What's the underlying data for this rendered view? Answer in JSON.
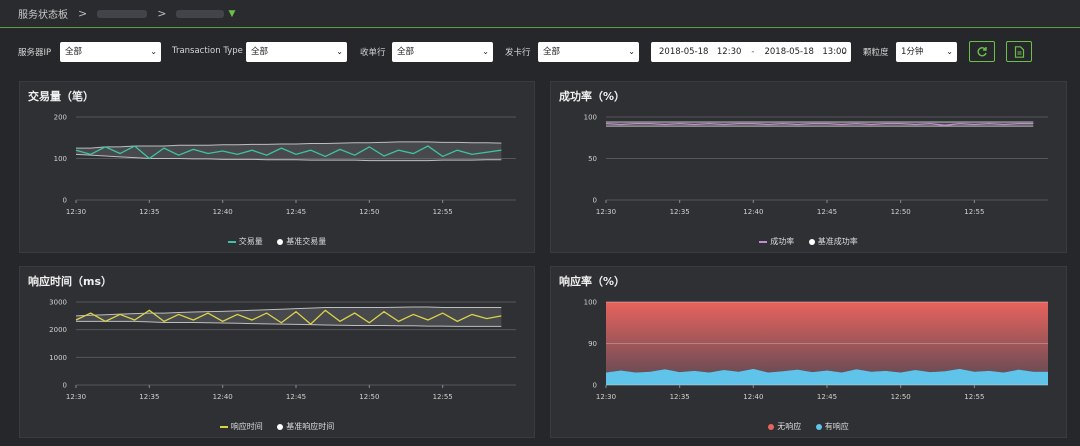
{
  "breadcrumb": {
    "root": "服务状态板",
    "sep": ">"
  },
  "filters": {
    "server_ip_label": "服务器IP",
    "server_ip_value": "全部",
    "txn_type_label": "Transaction Type",
    "txn_type_value": "全部",
    "acquirer_label": "收单行",
    "acquirer_value": "全部",
    "issuer_label": "发卡行",
    "issuer_value": "全部",
    "date_start": "2018-05-18　12:30",
    "date_sep": "-",
    "date_end": "2018-05-18　13:00",
    "granularity_label": "颗粒度",
    "granularity_value": "1分钟",
    "refresh_icon": "refresh-icon",
    "export_icon": "export-document-icon"
  },
  "colors": {
    "accent": "#6cc04a",
    "teal": "#3fc1a5",
    "pink": "#c58bd2",
    "yellow": "#d9d24a",
    "red": "#e8635d",
    "blue": "#5fc3ea",
    "baseline": "#bdbdbd"
  },
  "chart_data": [
    {
      "type": "line",
      "title": "交易量（笔）",
      "x": [
        "12:30",
        "12:35",
        "12:40",
        "12:45",
        "12:50",
        "12:55"
      ],
      "ylim": [
        0,
        200
      ],
      "yticks": [
        0,
        100,
        200
      ],
      "series": [
        {
          "name": "交易量",
          "color": "teal",
          "values": [
            120,
            110,
            128,
            112,
            130,
            100,
            125,
            108,
            122,
            112,
            118,
            110,
            120,
            108,
            125,
            110,
            120,
            105,
            122,
            108,
            128,
            106,
            120,
            112,
            130,
            105,
            120,
            110,
            115,
            120
          ]
        },
        {
          "name": "基准交易量",
          "color": "baseline",
          "band": true,
          "upper": [
            125,
            125,
            128,
            128,
            130,
            130,
            130,
            132,
            132,
            132,
            133,
            133,
            134,
            134,
            135,
            135,
            136,
            136,
            137,
            138,
            138,
            139,
            140,
            140,
            140,
            139,
            139,
            138,
            138,
            137
          ],
          "lower": [
            110,
            108,
            106,
            104,
            102,
            100,
            100,
            100,
            99,
            99,
            98,
            98,
            98,
            97,
            97,
            97,
            96,
            96,
            96,
            96,
            95,
            95,
            95,
            95,
            95,
            96,
            96,
            96,
            97,
            97
          ]
        }
      ],
      "legend": [
        "交易量",
        "基准交易量"
      ]
    },
    {
      "type": "line",
      "title": "成功率（%）",
      "x": [
        "12:30",
        "12:35",
        "12:40",
        "12:45",
        "12:50",
        "12:55"
      ],
      "ylim": [
        0,
        100
      ],
      "yticks": [
        0,
        50,
        100
      ],
      "series": [
        {
          "name": "成功率",
          "color": "pink",
          "values": [
            92,
            91,
            92,
            92,
            91,
            92,
            91,
            92,
            91,
            92,
            92,
            91,
            92,
            91,
            92,
            92,
            91,
            92,
            91,
            92,
            92,
            91,
            92,
            90,
            92,
            91,
            92,
            91,
            92,
            92
          ]
        },
        {
          "name": "基准成功率",
          "color": "baseline",
          "band": true,
          "upper": [
            94,
            94,
            94,
            94,
            94,
            94,
            94,
            94,
            94,
            94,
            94,
            94,
            94,
            94,
            94,
            94,
            94,
            94,
            94,
            94,
            94,
            94,
            94,
            94,
            94,
            94,
            94,
            94,
            94,
            94
          ],
          "lower": [
            89,
            89,
            89,
            89,
            89,
            89,
            89,
            89,
            89,
            89,
            89,
            89,
            89,
            89,
            89,
            89,
            89,
            89,
            89,
            89,
            89,
            89,
            89,
            89,
            89,
            89,
            89,
            89,
            89,
            89
          ]
        }
      ],
      "legend": [
        "成功率",
        "基准成功率"
      ]
    },
    {
      "type": "line",
      "title": "响应时间（ms）",
      "x": [
        "12:30",
        "12:35",
        "12:40",
        "12:45",
        "12:50",
        "12:55"
      ],
      "ylim": [
        0,
        3000
      ],
      "yticks": [
        0,
        1000,
        2000,
        3000
      ],
      "series": [
        {
          "name": "响应时间",
          "color": "yellow",
          "values": [
            2350,
            2600,
            2300,
            2550,
            2350,
            2700,
            2300,
            2550,
            2350,
            2600,
            2300,
            2550,
            2350,
            2600,
            2250,
            2650,
            2200,
            2700,
            2300,
            2600,
            2250,
            2650,
            2300,
            2550,
            2350,
            2600,
            2300,
            2550,
            2400,
            2500
          ]
        },
        {
          "name": "基准响应时间",
          "color": "baseline",
          "band": true,
          "upper": [
            2500,
            2520,
            2540,
            2560,
            2580,
            2600,
            2600,
            2620,
            2640,
            2650,
            2660,
            2680,
            2700,
            2720,
            2740,
            2760,
            2780,
            2800,
            2800,
            2800,
            2800,
            2800,
            2810,
            2820,
            2820,
            2800,
            2800,
            2800,
            2800,
            2800
          ],
          "lower": [
            2300,
            2300,
            2300,
            2300,
            2300,
            2280,
            2260,
            2260,
            2260,
            2250,
            2240,
            2230,
            2220,
            2210,
            2200,
            2190,
            2180,
            2170,
            2160,
            2150,
            2150,
            2150,
            2140,
            2140,
            2130,
            2130,
            2120,
            2120,
            2120,
            2120
          ]
        }
      ],
      "legend": [
        "响应时间",
        "基准响应时间"
      ]
    },
    {
      "type": "area",
      "title": "响应率（%）",
      "x": [
        "12:30",
        "12:35",
        "12:40",
        "12:45",
        "12:50",
        "12:55"
      ],
      "ylim": [
        80,
        100
      ],
      "yticks": [
        80,
        90,
        100
      ],
      "ytick_labels": [
        "0",
        "90",
        "100"
      ],
      "series": [
        {
          "name": "无响应",
          "color": "red",
          "values": [
            100,
            100,
            100,
            100,
            100,
            100,
            100,
            100,
            100,
            100,
            100,
            100,
            100,
            100,
            100,
            100,
            100,
            100,
            100,
            100,
            100,
            100,
            100,
            100,
            100,
            100,
            100,
            100,
            100,
            100
          ]
        },
        {
          "name": "有响应",
          "color": "blue",
          "values": [
            83,
            83.5,
            83,
            83.2,
            83.8,
            83.1,
            83.4,
            83,
            83.6,
            83.2,
            83.9,
            83,
            83.3,
            83.7,
            83.1,
            83.5,
            83,
            83.8,
            83.2,
            83.4,
            83,
            83.6,
            83.1,
            83.3,
            83.9,
            83.2,
            83.4,
            83,
            83.7,
            83.2
          ]
        }
      ],
      "legend": [
        "无响应",
        "有响应"
      ]
    }
  ]
}
